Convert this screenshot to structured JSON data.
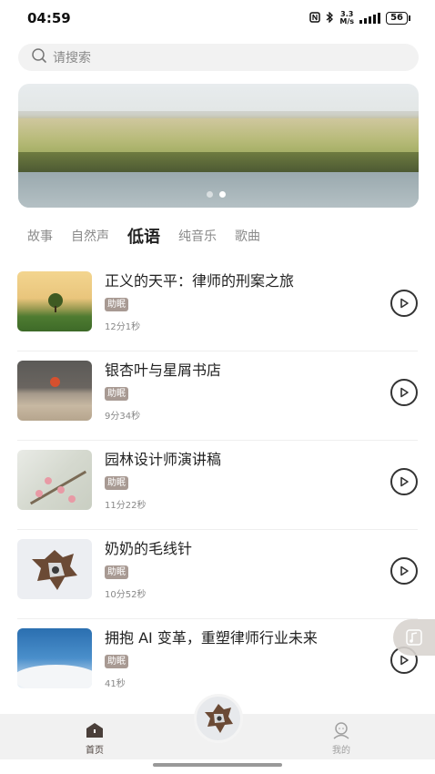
{
  "status": {
    "time": "04:59",
    "net_top": "3.3",
    "net_bottom": "M/s",
    "battery": "56"
  },
  "search": {
    "placeholder": "请搜索"
  },
  "tabs": [
    {
      "label": "故事"
    },
    {
      "label": "自然声"
    },
    {
      "label": "低语"
    },
    {
      "label": "纯音乐"
    },
    {
      "label": "歌曲"
    }
  ],
  "items": [
    {
      "title": "正义的天平：律师的刑案之旅",
      "tag": "助眠",
      "duration": "12分1秒"
    },
    {
      "title": "银杏叶与星屑书店",
      "tag": "助眠",
      "duration": "9分34秒"
    },
    {
      "title": "园林设计师演讲稿",
      "tag": "助眠",
      "duration": "11分22秒"
    },
    {
      "title": "奶奶的毛线针",
      "tag": "助眠",
      "duration": "10分52秒"
    },
    {
      "title": "拥抱 AI 变革，重塑律师行业未来",
      "tag": "助眠",
      "duration": "41秒"
    }
  ],
  "nav": {
    "home": "首页",
    "mine": "我的"
  },
  "colors": {
    "accent": "#4a3f3a",
    "tag_bg": "#a89a93"
  }
}
